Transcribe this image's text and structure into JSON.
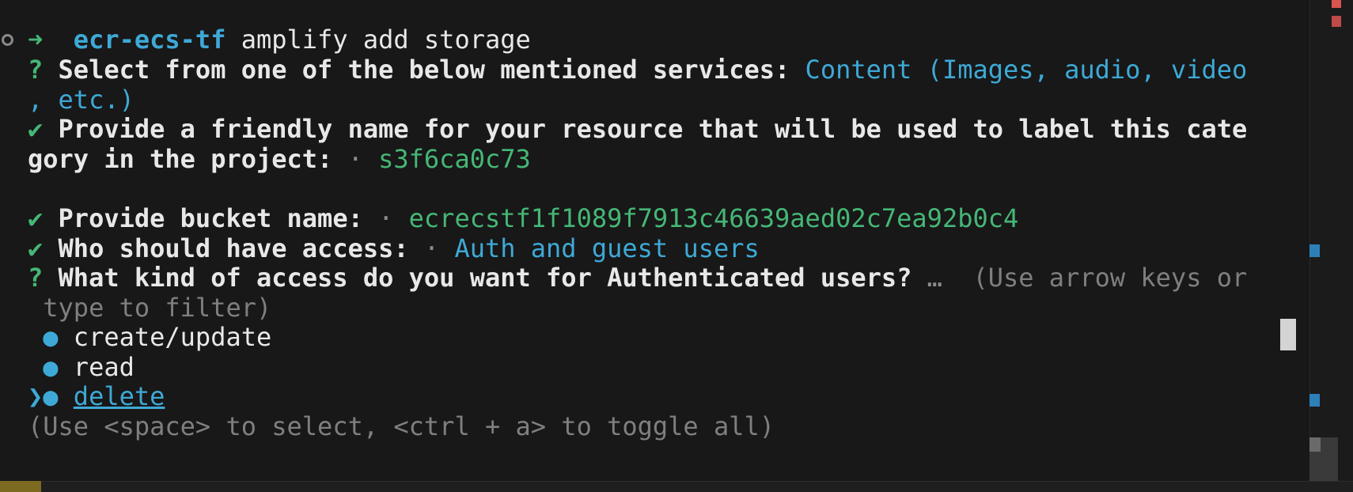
{
  "prompt": {
    "arrow": "➜",
    "directory": "ecr-ecs-tf",
    "command": "amplify add storage"
  },
  "q1": {
    "mark": "?",
    "question": "Select from one of the below mentioned services:",
    "answer_part1": "Content (Images, audio, video",
    "answer_part2": ", etc.)"
  },
  "q2": {
    "mark": "✔",
    "question_part1": "Provide a friendly name for your resource that will be used to label this cate",
    "question_part2": "gory in the project:",
    "sep": "·",
    "answer": "s3f6ca0c73"
  },
  "q3": {
    "mark": "✔",
    "question": "Provide bucket name:",
    "sep": "·",
    "answer": "ecrecstf1f1089f7913c46639aed02c7ea92b0c4"
  },
  "q4": {
    "mark": "✔",
    "question": "Who should have access:",
    "sep": "·",
    "answer": "Auth and guest users"
  },
  "q5": {
    "mark": "?",
    "question": "What kind of access do you want for Authenticated users?",
    "ellipsis": "…",
    "hint_part1": "(Use arrow keys or",
    "hint_part2": " type to filter)"
  },
  "options": [
    {
      "pointer": " ",
      "bullet": "●",
      "label": "create/update"
    },
    {
      "pointer": " ",
      "bullet": "●",
      "label": "read"
    },
    {
      "pointer": "❯",
      "bullet": "●",
      "label": "delete"
    }
  ],
  "footer_hint": "(Use <space> to select, <ctrl + a> to toggle all)",
  "colors": {
    "background": "#181818",
    "cyan": "#3ea9d6",
    "green": "#45b776",
    "text": "#e8e8e8",
    "dim": "#8b8b8b"
  }
}
